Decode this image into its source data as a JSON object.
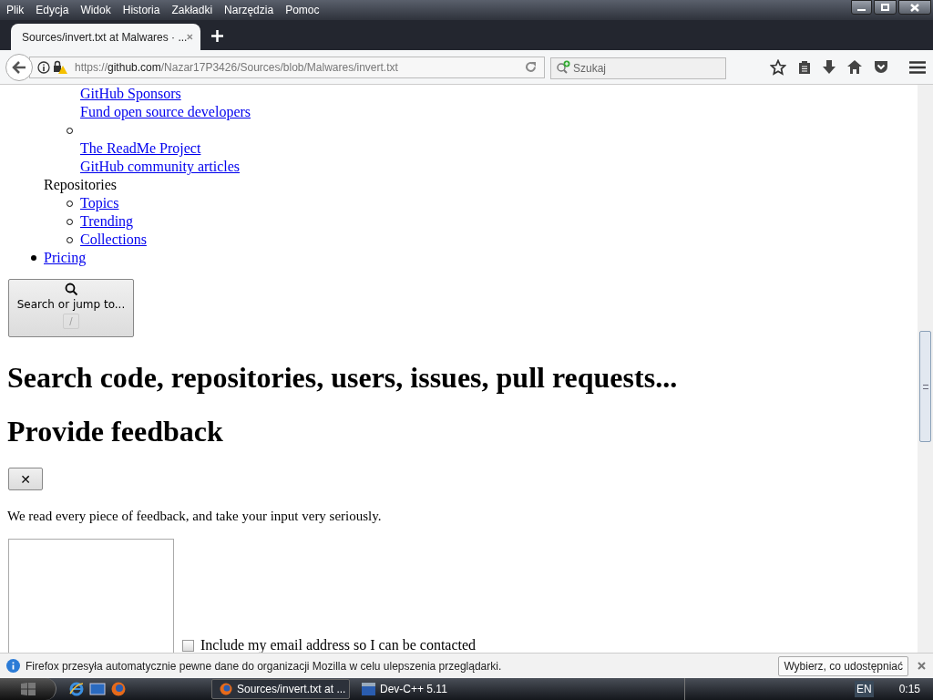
{
  "menu": [
    "Plik",
    "Edycja",
    "Widok",
    "Historia",
    "Zakładki",
    "Narzędzia",
    "Pomoc"
  ],
  "tabs": [
    {
      "title": "Sources/invert.txt at Malwares · ...",
      "selected": true
    }
  ],
  "address_bar": {
    "scheme": "https://",
    "host": "github.com",
    "path": "/Nazar17P3426/Sources/blob/Malwares/invert.txt"
  },
  "search": {
    "placeholder": "Szukaj"
  },
  "page": {
    "nav_list": [
      {
        "bullet": false,
        "children": [
          {
            "bullet": false,
            "links": [
              "GitHub Sponsors",
              "Fund open source developers"
            ]
          },
          {
            "bullet": true,
            "links": [
              "The ReadMe Project",
              "GitHub community articles"
            ]
          }
        ]
      },
      {
        "bullet": false,
        "heading": "Repositories",
        "children": [
          {
            "bullet": true,
            "links": [
              "Topics"
            ]
          },
          {
            "bullet": true,
            "links": [
              "Trending"
            ]
          },
          {
            "bullet": true,
            "links": [
              "Collections"
            ]
          }
        ]
      },
      {
        "bullet": true,
        "links": [
          "Pricing"
        ]
      }
    ],
    "search_button": {
      "label": "Search or jump to...",
      "shortcut": "/"
    },
    "headings": [
      "Search code, repositories, users, issues, pull requests...",
      "Provide feedback"
    ],
    "close_button": "✕",
    "paragraph": "We read every piece of feedback, and take your input very seriously.",
    "checkbox": {
      "label": "Include my email address so I can be contacted",
      "checked": false
    }
  },
  "notification": {
    "text": "Firefox przesyła automatycznie pewne dane do organizacji Mozilla w celu ulepszenia przeglądarki.",
    "button": "Wybierz, co udostępniać"
  },
  "taskbar": {
    "tasks": [
      {
        "title": "Sources/invert.txt at ...",
        "selected": true,
        "kind": "firefox"
      },
      {
        "title": "Dev-C++ 5.11",
        "selected": false,
        "kind": "devcpp"
      }
    ],
    "language": "EN",
    "clock": "0:15"
  }
}
